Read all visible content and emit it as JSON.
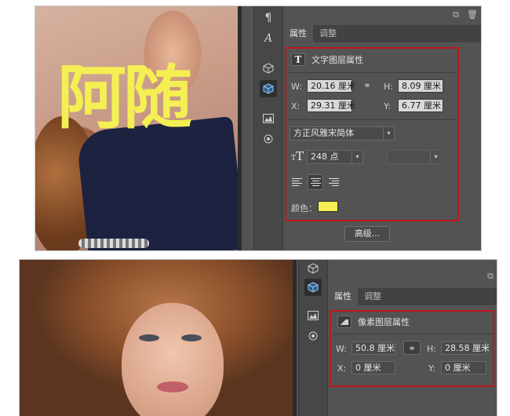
{
  "panel1": {
    "overlay_text": "阿随",
    "tabs": [
      "属性",
      "调整"
    ],
    "section_title": "文字图层属性",
    "width": {
      "label": "W:",
      "value": "20.16 厘米"
    },
    "height": {
      "label": "H:",
      "value": "8.09 厘米"
    },
    "x": {
      "label": "X:",
      "value": "29.31 厘米"
    },
    "y": {
      "label": "Y:",
      "value": "6.77 厘米"
    },
    "font_family": "方正风雅宋简体",
    "font_size": "248 点",
    "color_label": "颜色：",
    "color_value": "#f4ef52",
    "advanced_button": "高级..."
  },
  "panel2": {
    "tabs": [
      "属性",
      "调整"
    ],
    "section_title": "像素图层属性",
    "width": {
      "label": "W:",
      "value": "50.8 厘米"
    },
    "height": {
      "label": "H:",
      "value": "28.58 厘米"
    },
    "x": {
      "label": "X:",
      "value": "0 厘米"
    },
    "y": {
      "label": "Y:",
      "value": "0 厘米"
    }
  },
  "icons": {
    "paragraph": "¶",
    "character": "A",
    "link": "⚭",
    "new_doc": "⧉",
    "trash": "🗑",
    "caret": "▾"
  },
  "accent_colors": {
    "highlight_box": "#c0161c",
    "panel_bg": "#535353"
  }
}
